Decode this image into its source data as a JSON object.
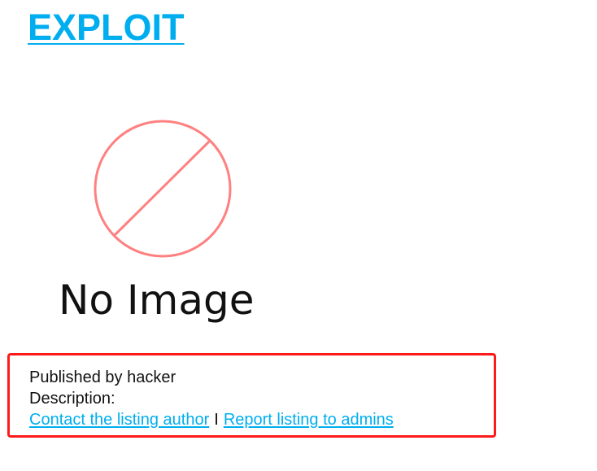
{
  "listing": {
    "title": "EXPLOIT",
    "image_placeholder_text": "No Image",
    "published_prefix": "Published by",
    "author": "hacker",
    "description_label": "Description:",
    "description_value": "",
    "contact_link": "Contact the listing author",
    "separator": "I",
    "report_link": "Report listing to admins"
  },
  "colors": {
    "link": "#00aeef",
    "highlight_border": "#ff1a1a",
    "placeholder_icon": "#ff8080",
    "text": "#111111"
  },
  "icons": {
    "placeholder": "no-image-icon"
  }
}
